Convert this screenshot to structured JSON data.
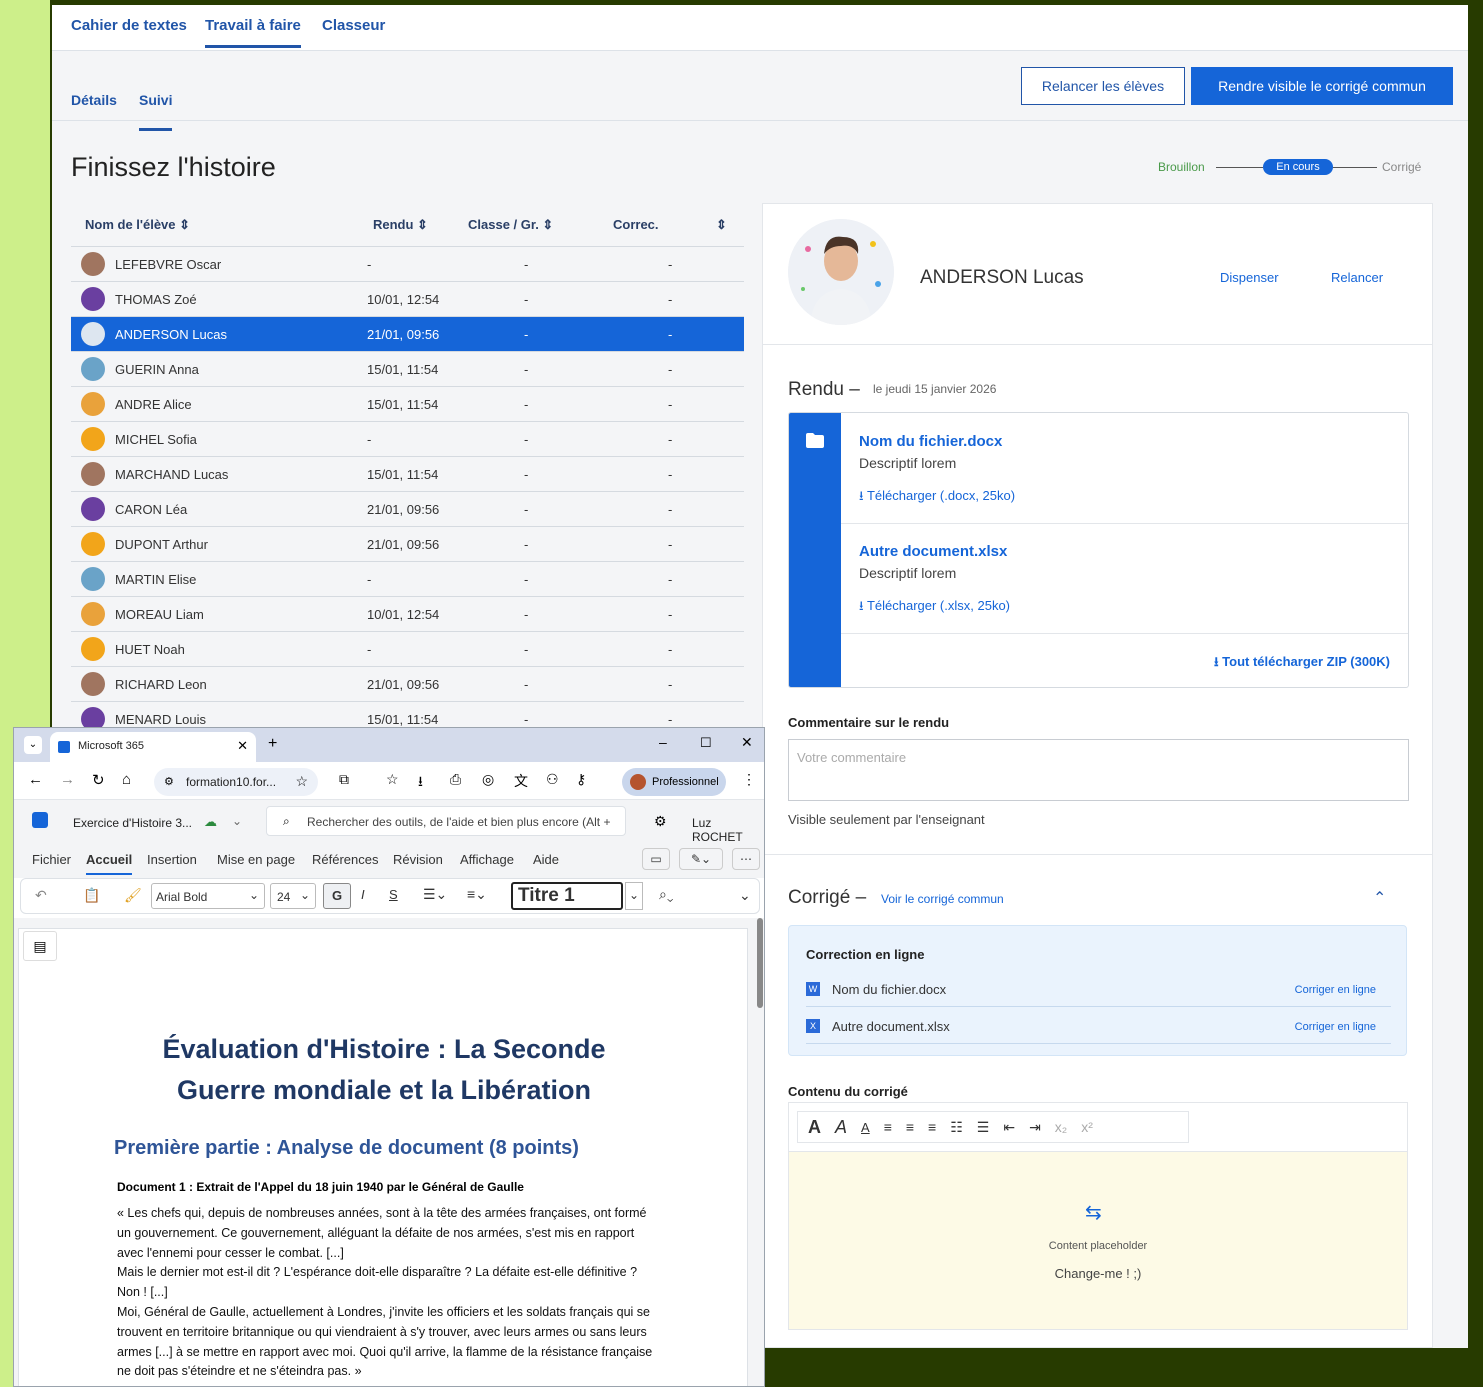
{
  "nav": {
    "tab1": "Cahier de textes",
    "tab2": "Travail à faire",
    "tab3": "Classeur",
    "sub1": "Détails",
    "sub2": "Suivi",
    "btn_relancer": "Relancer les élèves",
    "btn_visible": "Rendre visible le corrigé commun"
  },
  "page_title": "Finissez l'histoire",
  "steps": {
    "s1": "Brouillon",
    "s2": "En cours",
    "s3": "Corrigé"
  },
  "table": {
    "headers": {
      "name": "Nom de l'élève ⇕",
      "rendu": "Rendu ⇕",
      "classe": "Classe / Gr. ⇕",
      "correc": "Correc.",
      "sort": "⇕"
    },
    "rows": [
      {
        "name": "LEFEBVRE Oscar",
        "rendu": "-",
        "classe": "-",
        "correc": "-",
        "color": "#a07560"
      },
      {
        "name": "THOMAS Zoé",
        "rendu": "10/01, 12:54",
        "classe": "-",
        "correc": "-",
        "color": "#6a3fa0"
      },
      {
        "name": "ANDERSON Lucas",
        "rendu": "21/01, 09:56",
        "classe": "-",
        "correc": "-",
        "color": "#dde6f0"
      },
      {
        "name": "GUERIN Anna",
        "rendu": "15/01, 11:54",
        "classe": "-",
        "correc": "-",
        "color": "#6aa3c8"
      },
      {
        "name": "ANDRE Alice",
        "rendu": "15/01, 11:54",
        "classe": "-",
        "correc": "-",
        "color": "#e9a23b"
      },
      {
        "name": "MICHEL Sofia",
        "rendu": "-",
        "classe": "-",
        "correc": "-",
        "color": "#f2a51a"
      },
      {
        "name": "MARCHAND Lucas",
        "rendu": "15/01, 11:54",
        "classe": "-",
        "correc": "-",
        "color": "#a07560"
      },
      {
        "name": "CARON Léa",
        "rendu": "21/01, 09:56",
        "classe": "-",
        "correc": "-",
        "color": "#6a3fa0"
      },
      {
        "name": "DUPONT Arthur",
        "rendu": "21/01, 09:56",
        "classe": "-",
        "correc": "-",
        "color": "#f2a51a"
      },
      {
        "name": "MARTIN Elise",
        "rendu": "-",
        "classe": "-",
        "correc": "-",
        "color": "#6aa3c8"
      },
      {
        "name": "MOREAU Liam",
        "rendu": "10/01, 12:54",
        "classe": "-",
        "correc": "-",
        "color": "#e9a23b"
      },
      {
        "name": "HUET Noah",
        "rendu": "-",
        "classe": "-",
        "correc": "-",
        "color": "#f2a51a"
      },
      {
        "name": "RICHARD Leon",
        "rendu": "21/01, 09:56",
        "classe": "-",
        "correc": "-",
        "color": "#a07560"
      },
      {
        "name": "MENARD Louis",
        "rendu": "15/01, 11:54",
        "classe": "-",
        "correc": "-",
        "color": "#6a3fa0"
      }
    ]
  },
  "student": {
    "name": "ANDERSON Lucas",
    "dispenser": "Dispenser",
    "relancer": "Relancer",
    "rendu_label": "Rendu –",
    "rendu_date": "le jeudi 15 janvier 2026",
    "files": [
      {
        "name": "Nom du fichier.docx",
        "desc": "Descriptif lorem",
        "dl": "Télécharger (.docx, 25ko)"
      },
      {
        "name": "Autre document.xlsx",
        "desc": "Descriptif lorem",
        "dl": "Télécharger (.xlsx, 25ko)"
      }
    ],
    "zip": "Tout télécharger ZIP (300K)",
    "comment_label": "Commentaire sur le rendu",
    "comment_placeholder": "Votre commentaire",
    "comment_note": "Visible seulement par l'enseignant",
    "corrige_label": "Corrigé –",
    "corrige_link": "Voir le corrigé commun",
    "correction_title": "Correction en ligne",
    "corr_files": [
      {
        "name": "Nom du fichier.docx",
        "action": "Corriger en ligne"
      },
      {
        "name": "Autre document.xlsx",
        "action": "Corriger en ligne"
      }
    ],
    "contenu_label": "Contenu du corrigé",
    "placeholder_title": "Content placeholder",
    "placeholder_text": "Change-me ! ;)"
  },
  "browser": {
    "tab_title": "Microsoft 365",
    "url": "formation10.for...",
    "profile": "Professionnel",
    "doc_title": "Exercice d'Histoire 3...",
    "search_placeholder": "Rechercher des outils, de l'aide et bien plus encore (Alt +",
    "user": "Luz ROCHET",
    "menus": [
      "Fichier",
      "Accueil",
      "Insertion",
      "Mise en page",
      "Références",
      "Révision",
      "Affichage",
      "Aide"
    ],
    "font": "Arial Bold",
    "size": "24",
    "bold": "G",
    "italic": "I",
    "strike": "S",
    "style": "Titre 1"
  },
  "document": {
    "title_l1": "Évaluation d'Histoire : La Seconde",
    "title_l2": "Guerre mondiale et la Libération",
    "h2": "Première partie : Analyse de document (8 points)",
    "doc_label": "Document 1 : Extrait de l'Appel du 18 juin 1940 par le Général de Gaulle",
    "p1": "« Les chefs qui, depuis de nombreuses années, sont à la tête des armées françaises, ont formé un gouvernement. Ce gouvernement, alléguant la défaite de nos armées, s'est mis en rapport avec l'ennemi pour cesser le combat. [...]",
    "p2": "Mais le dernier mot est-il dit ? L'espérance doit-elle disparaître ? La défaite est-elle définitive ? Non ! [...]",
    "p3": "Moi, Général de Gaulle, actuellement à Londres, j'invite les officiers et les soldats français qui se trouvent en territoire britannique ou qui viendraient à s'y trouver, avec leurs armes ou sans leurs armes [...] à se mettre en rapport avec moi. Quoi qu'il arrive, la flamme de la résistance française ne doit pas s'éteindre et ne s'éteindra pas. »"
  }
}
